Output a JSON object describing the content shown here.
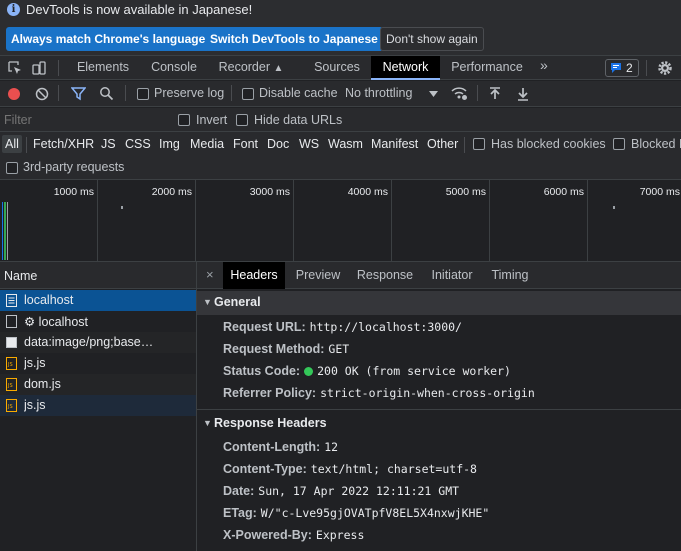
{
  "infobar": {
    "icon": "info-icon",
    "message": "DevTools is now available in Japanese!",
    "btn_match": "Always match Chrome's language",
    "btn_switch": "Switch DevTools to Japanese",
    "btn_dismiss": "Don't show again"
  },
  "tabs": {
    "elements": "Elements",
    "console": "Console",
    "recorder": "Recorder",
    "sources": "Sources",
    "network": "Network",
    "performance": "Performance",
    "more": "»",
    "issues_count": "2"
  },
  "toolbar": {
    "preserve_log": "Preserve log",
    "disable_cache": "Disable cache",
    "throttling": "No throttling"
  },
  "filter": {
    "placeholder": "Filter",
    "invert": "Invert",
    "hide_data_urls": "Hide data URLs"
  },
  "type_filters": [
    "All",
    "Fetch/XHR",
    "JS",
    "CSS",
    "Img",
    "Media",
    "Font",
    "Doc",
    "WS",
    "Wasm",
    "Manifest",
    "Other"
  ],
  "blocked": {
    "has_blocked_cookies": "Has blocked cookies",
    "blocked_requests": "Blocked R"
  },
  "third_party": "3rd-party requests",
  "timeline_ticks": [
    "1000 ms",
    "2000 ms",
    "3000 ms",
    "4000 ms",
    "5000 ms",
    "6000 ms",
    "7000 ms"
  ],
  "requests": {
    "header": "Name",
    "items": [
      {
        "name": "localhost",
        "icon": "document-icon"
      },
      {
        "name": "⚙ localhost",
        "icon": "document-icon"
      },
      {
        "name": "data:image/png;base…",
        "icon": "image-icon"
      },
      {
        "name": "js.js",
        "icon": "script-icon"
      },
      {
        "name": "dom.js",
        "icon": "script-icon"
      },
      {
        "name": "js.js",
        "icon": "script-icon"
      }
    ]
  },
  "details": {
    "close": "×",
    "tabs": [
      "Headers",
      "Preview",
      "Response",
      "Initiator",
      "Timing"
    ],
    "general_title": "General",
    "general": [
      {
        "key": "Request URL:",
        "value": "http://localhost:3000/"
      },
      {
        "key": "Request Method:",
        "value": "GET"
      },
      {
        "key": "Status Code:",
        "value": "200 OK (from service worker)"
      },
      {
        "key": "Referrer Policy:",
        "value": "strict-origin-when-cross-origin"
      }
    ],
    "response_title": "Response Headers",
    "response": [
      {
        "key": "Content-Length:",
        "value": "12"
      },
      {
        "key": "Content-Type:",
        "value": "text/html; charset=utf-8"
      },
      {
        "key": "Date:",
        "value": "Sun, 17 Apr 2022 12:11:21 GMT"
      },
      {
        "key": "ETag:",
        "value": "W/\"c-Lve95gjOVATpfV8EL5X4nxwjKHE\""
      },
      {
        "key": "X-Powered-By:",
        "value": "Express"
      }
    ]
  },
  "colors": {
    "accent": "#1a73c8",
    "record": "#e94f4f",
    "filter_active": "#8ab4f8",
    "status_ok": "#34c759"
  }
}
